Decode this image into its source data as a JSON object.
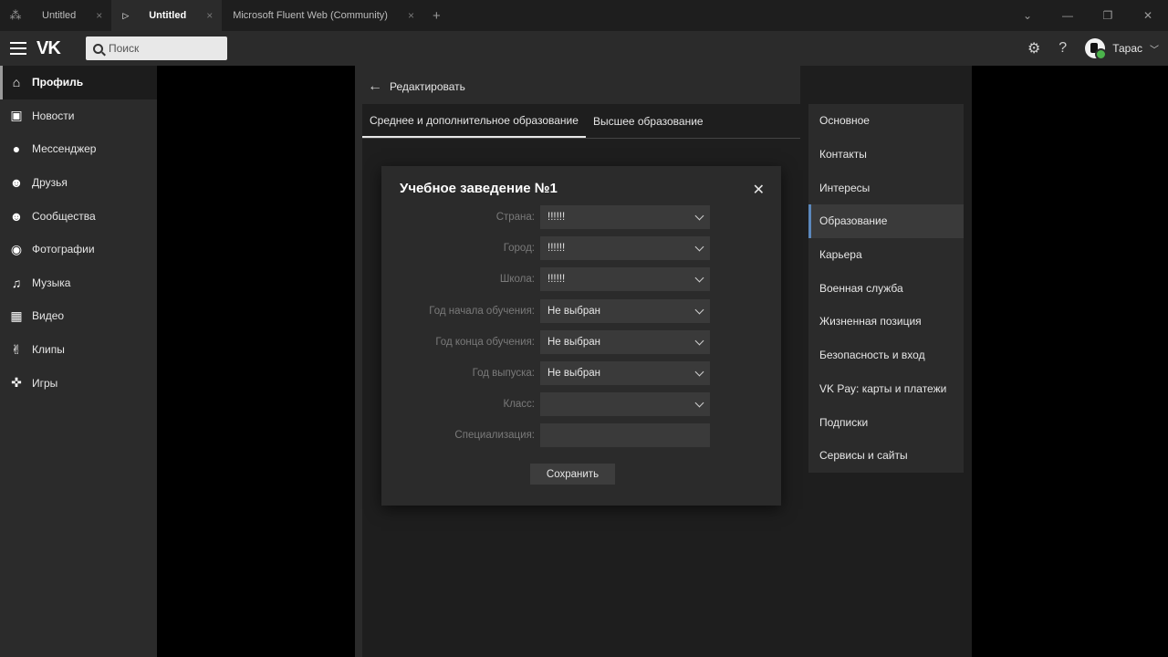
{
  "browser": {
    "tabs": [
      {
        "label": "Untitled",
        "active": false
      },
      {
        "label": "Untitled",
        "active": true
      },
      {
        "label": "Microsoft Fluent Web (Community)",
        "active": false
      }
    ],
    "add_tab": "+",
    "close_glyph": "×",
    "window_controls": [
      "⌄",
      "—",
      "❐",
      "✕"
    ]
  },
  "header": {
    "logo": "VK",
    "search_placeholder": "Поиск",
    "user_name": "Тарас"
  },
  "sidebar": {
    "items": [
      {
        "label": "Профиль",
        "icon": "home-icon",
        "glyph": "⌂",
        "active": true
      },
      {
        "label": "Новости",
        "icon": "news-icon",
        "glyph": "▣",
        "active": false
      },
      {
        "label": "Мессенджер",
        "icon": "chat-icon",
        "glyph": "●",
        "active": false
      },
      {
        "label": "Друзья",
        "icon": "friend-icon",
        "glyph": "☻",
        "active": false
      },
      {
        "label": "Сообщества",
        "icon": "community-icon",
        "glyph": "☻",
        "active": false
      },
      {
        "label": "Фотографии",
        "icon": "camera-icon",
        "glyph": "◉",
        "active": false
      },
      {
        "label": "Музыка",
        "icon": "music-icon",
        "glyph": "♫",
        "active": false
      },
      {
        "label": "Видео",
        "icon": "video-icon",
        "glyph": "▦",
        "active": false
      },
      {
        "label": "Клипы",
        "icon": "clips-icon",
        "glyph": "✌",
        "active": false
      },
      {
        "label": "Игры",
        "icon": "gamepad-icon",
        "glyph": "✜",
        "active": false
      }
    ]
  },
  "main": {
    "back_label": "Редактировать",
    "tabs": [
      {
        "label": "Среднее и дополнительное образование",
        "active": true
      },
      {
        "label": "Высшее образование",
        "active": false
      }
    ]
  },
  "dialog": {
    "title": "Учебное заведение №1",
    "fields": [
      {
        "label": "Страна:",
        "value": "!!!!!!",
        "type": "select"
      },
      {
        "label": "Город:",
        "value": "!!!!!!",
        "type": "select"
      },
      {
        "label": "Школа:",
        "value": "!!!!!!",
        "type": "select"
      },
      {
        "label": "Год начала обучения:",
        "value": "Не выбран",
        "type": "select"
      },
      {
        "label": "Год конца обучения:",
        "value": "Не выбран",
        "type": "select"
      },
      {
        "label": "Год выпуска:",
        "value": "Не выбран",
        "type": "select"
      },
      {
        "label": "Класс:",
        "value": "",
        "type": "select"
      },
      {
        "label": "Специализация:",
        "value": "",
        "type": "input"
      }
    ],
    "save_label": "Сохранить"
  },
  "right_menu": {
    "items": [
      {
        "label": "Основное",
        "active": false
      },
      {
        "label": "Контакты",
        "active": false
      },
      {
        "label": "Интересы",
        "active": false
      },
      {
        "label": "Образование",
        "active": true
      },
      {
        "label": "Карьера",
        "active": false
      },
      {
        "label": "Военная служба",
        "active": false
      },
      {
        "label": "Жизненная позиция",
        "active": false
      },
      {
        "label": "Безопасность и вход",
        "active": false
      },
      {
        "label": "VK Pay: карты и платежи",
        "active": false
      },
      {
        "label": "Подписки",
        "active": false
      },
      {
        "label": "Сервисы и сайты",
        "active": false
      }
    ]
  },
  "colors": {
    "accent": "#5b88bd",
    "online": "#4bb34b"
  }
}
